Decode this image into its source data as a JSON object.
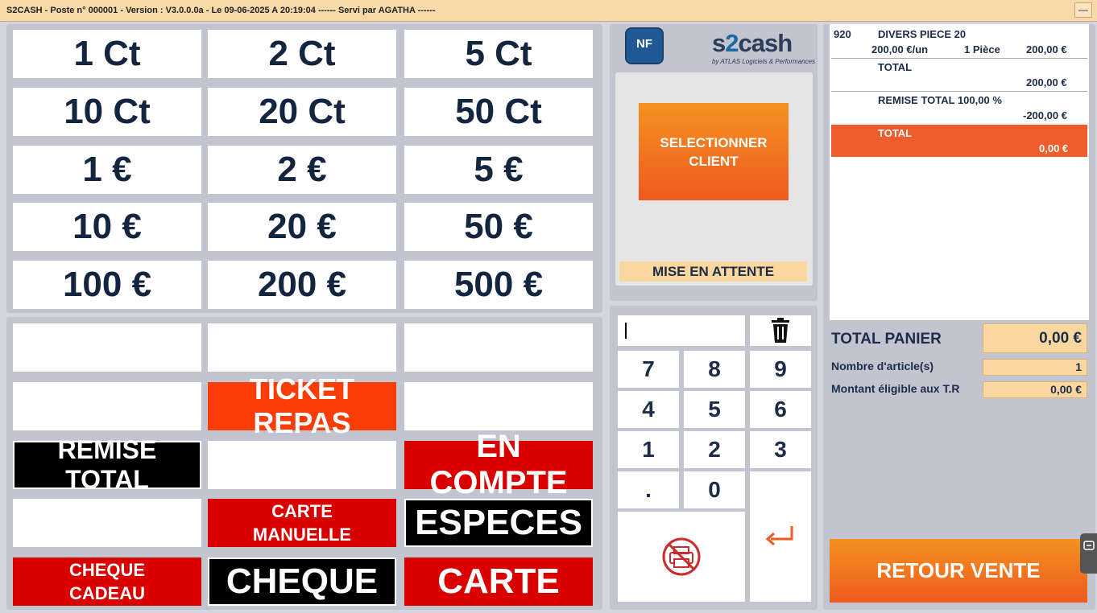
{
  "title_bar": {
    "text": "S2CASH - Poste n° 000001 - Version : V3.0.0.0a - Le 09-06-2025 A 20:19:04 ------ Servi par AGATHA ------",
    "minimize": "—"
  },
  "coins": [
    "1 Ct",
    "2 Ct",
    "5 Ct",
    "10 Ct",
    "20 Ct",
    "50 Ct",
    "1 €",
    "2 €",
    "5 €",
    "10 €",
    "20 €",
    "50 €",
    "100 €",
    "200 €",
    "500 €"
  ],
  "payments": {
    "ticket_repas": "TICKET REPAS",
    "remise_total": "REMISE TOTAL",
    "en_compte": "EN COMPTE",
    "carte_manuelle_1": "CARTE",
    "carte_manuelle_2": "MANUELLE",
    "especes": "ESPECES",
    "cheque_cadeau_1": "CHEQUE",
    "cheque_cadeau_2": "CADEAU",
    "cheque": "CHEQUE",
    "carte": "CARTE"
  },
  "brand": {
    "nf": "NF",
    "logo_s": "s",
    "logo_2": "2",
    "logo_cash": "cash",
    "tagline": "by ATLAS Logiciels & Performances"
  },
  "client": {
    "select_line1": "SELECTIONNER",
    "select_line2": "CLIENT",
    "mise_en_attente": "MISE EN ATTENTE"
  },
  "keypad": {
    "keys": [
      "7",
      "8",
      "9",
      "4",
      "5",
      "6",
      "1",
      "2",
      "3",
      ".",
      "0"
    ],
    "display_value": ""
  },
  "ticket": {
    "item_code": "920",
    "item_name": "DIVERS PIECE 20",
    "item_unit_price": "200,00 €/un",
    "item_qty": "1 Pièce",
    "item_amount": "200,00 €",
    "total_label": "TOTAL",
    "total_value": "200,00 €",
    "remise_label": "REMISE TOTAL 100,00 %",
    "remise_value": "-200,00 €",
    "final_total_label": "TOTAL",
    "final_total_value": "0,00 €"
  },
  "summary": {
    "total_panier_label": "TOTAL PANIER",
    "total_panier_value": "0,00 €",
    "nb_articles_label": "Nombre d'article(s)",
    "nb_articles_value": "1",
    "montant_tr_label": "Montant éligible aux T.R",
    "montant_tr_value": "0,00 €"
  },
  "retour_vente": "RETOUR VENTE",
  "colors": {
    "title_bar": "#f9d9a8",
    "accent_orange": "#ee5a1f",
    "red": "#d90000",
    "ticket_orange": "#fa3d06",
    "panel": "#c2c4d0",
    "text_navy": "#1d2c48"
  }
}
